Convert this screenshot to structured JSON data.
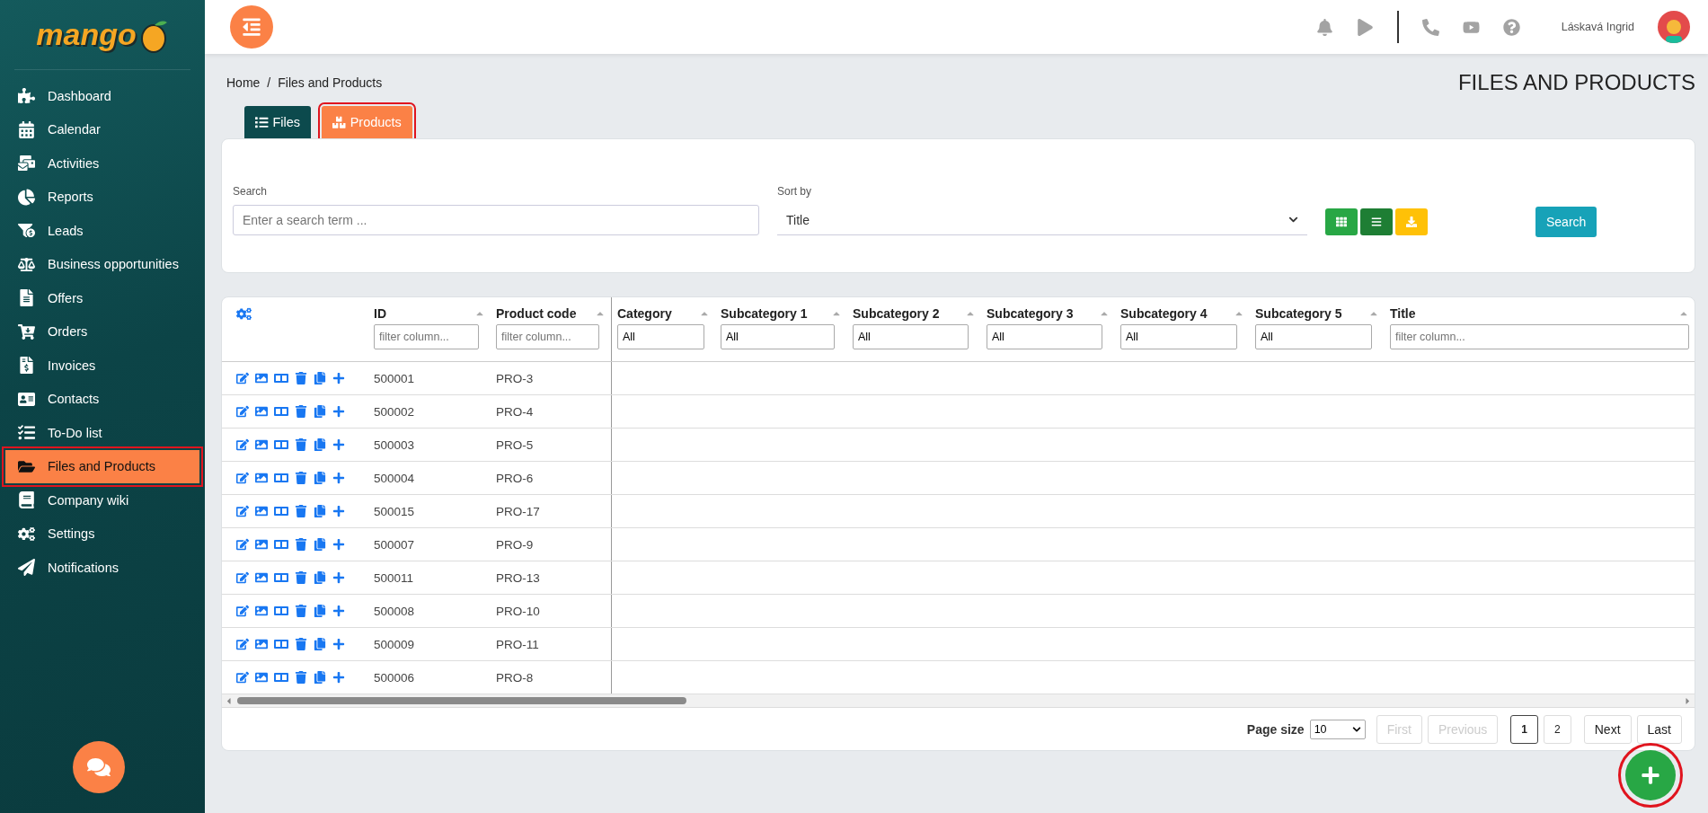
{
  "brand": {
    "name": "mango"
  },
  "sidebar": {
    "items": [
      {
        "label": "Dashboard",
        "selected": false
      },
      {
        "label": "Calendar",
        "selected": false
      },
      {
        "label": "Activities",
        "selected": false
      },
      {
        "label": "Reports",
        "selected": false
      },
      {
        "label": "Leads",
        "selected": false
      },
      {
        "label": "Business opportunities",
        "selected": false
      },
      {
        "label": "Offers",
        "selected": false
      },
      {
        "label": "Orders",
        "selected": false
      },
      {
        "label": "Invoices",
        "selected": false
      },
      {
        "label": "Contacts",
        "selected": false
      },
      {
        "label": "To-Do list",
        "selected": false
      },
      {
        "label": "Files and Products",
        "selected": true
      },
      {
        "label": "Company wiki",
        "selected": false
      },
      {
        "label": "Settings",
        "selected": false
      },
      {
        "label": "Notifications",
        "selected": false
      }
    ]
  },
  "header": {
    "user": "Láskavá Ingrid"
  },
  "breadcrumb": {
    "items": [
      "Home",
      "Files and Products"
    ],
    "separator": "/"
  },
  "page_title": "FILES AND PRODUCTS",
  "tabs": [
    {
      "label": "Files",
      "selected": false
    },
    {
      "label": "Products",
      "selected": true
    }
  ],
  "search": {
    "label": "Search",
    "placeholder": "Enter a search term ...",
    "sort_label": "Sort by",
    "sort_value": "Title",
    "button": "Search"
  },
  "table": {
    "columns": [
      {
        "name": "ID",
        "placeholder": "filter column..."
      },
      {
        "name": "Product code",
        "placeholder": "filter column..."
      },
      {
        "name": "Category",
        "value": "All"
      },
      {
        "name": "Subcategory 1",
        "value": "All"
      },
      {
        "name": "Subcategory 2",
        "value": "All"
      },
      {
        "name": "Subcategory 3",
        "value": "All"
      },
      {
        "name": "Subcategory 4",
        "value": "All"
      },
      {
        "name": "Subcategory 5",
        "value": "All"
      },
      {
        "name": "Title",
        "placeholder": "filter column..."
      }
    ],
    "rows": [
      {
        "id": "500001",
        "code": "PRO-3"
      },
      {
        "id": "500002",
        "code": "PRO-4"
      },
      {
        "id": "500003",
        "code": "PRO-5"
      },
      {
        "id": "500004",
        "code": "PRO-6"
      },
      {
        "id": "500015",
        "code": "PRO-17"
      },
      {
        "id": "500007",
        "code": "PRO-9"
      },
      {
        "id": "500011",
        "code": "PRO-13"
      },
      {
        "id": "500008",
        "code": "PRO-10"
      },
      {
        "id": "500009",
        "code": "PRO-11"
      },
      {
        "id": "500006",
        "code": "PRO-8"
      }
    ]
  },
  "pagination": {
    "page_size_label": "Page size",
    "page_size": "10",
    "nav_before": [
      {
        "label": "First",
        "disabled": true
      },
      {
        "label": "Previous",
        "disabled": true
      }
    ],
    "pages": [
      {
        "label": "1",
        "selected": true
      },
      {
        "label": "2",
        "selected": false
      }
    ],
    "nav_after": [
      {
        "label": "Next",
        "disabled": false
      },
      {
        "label": "Last",
        "disabled": false
      }
    ]
  },
  "fab": {
    "highlighted": true
  }
}
